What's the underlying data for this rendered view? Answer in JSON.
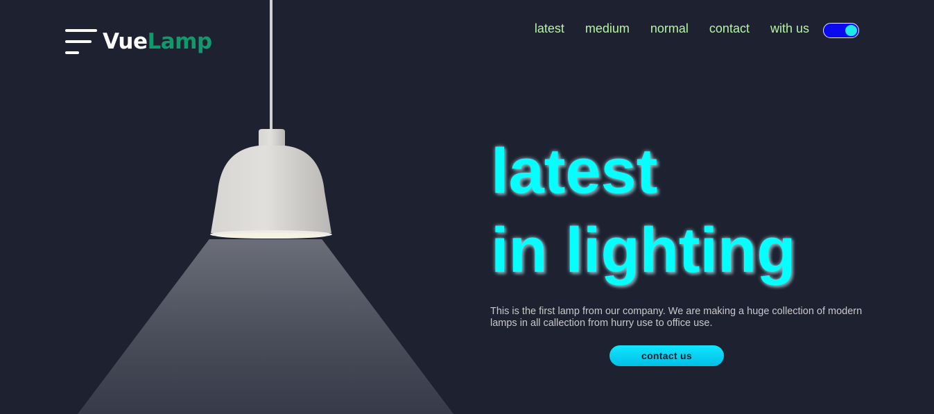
{
  "brand": {
    "part1": "Vue",
    "part2": "Lamp"
  },
  "nav": {
    "items": [
      "latest",
      "medium",
      "normal",
      "contact",
      "with us"
    ]
  },
  "theme_toggle": {
    "state": "on"
  },
  "hero": {
    "title_line1": "latest",
    "title_line2": "in lighting",
    "description": "This is the first lamp from our company. We are making a huge collection of modern lamps in all callection from hurry use to office use.",
    "cta_label": "contact us"
  },
  "colors": {
    "background": "#1e2130",
    "accent_cyan": "#04ffff",
    "nav_text": "#b7f5a2",
    "brand_green": "#0e9a6a",
    "toggle_track": "#0a0af0"
  }
}
